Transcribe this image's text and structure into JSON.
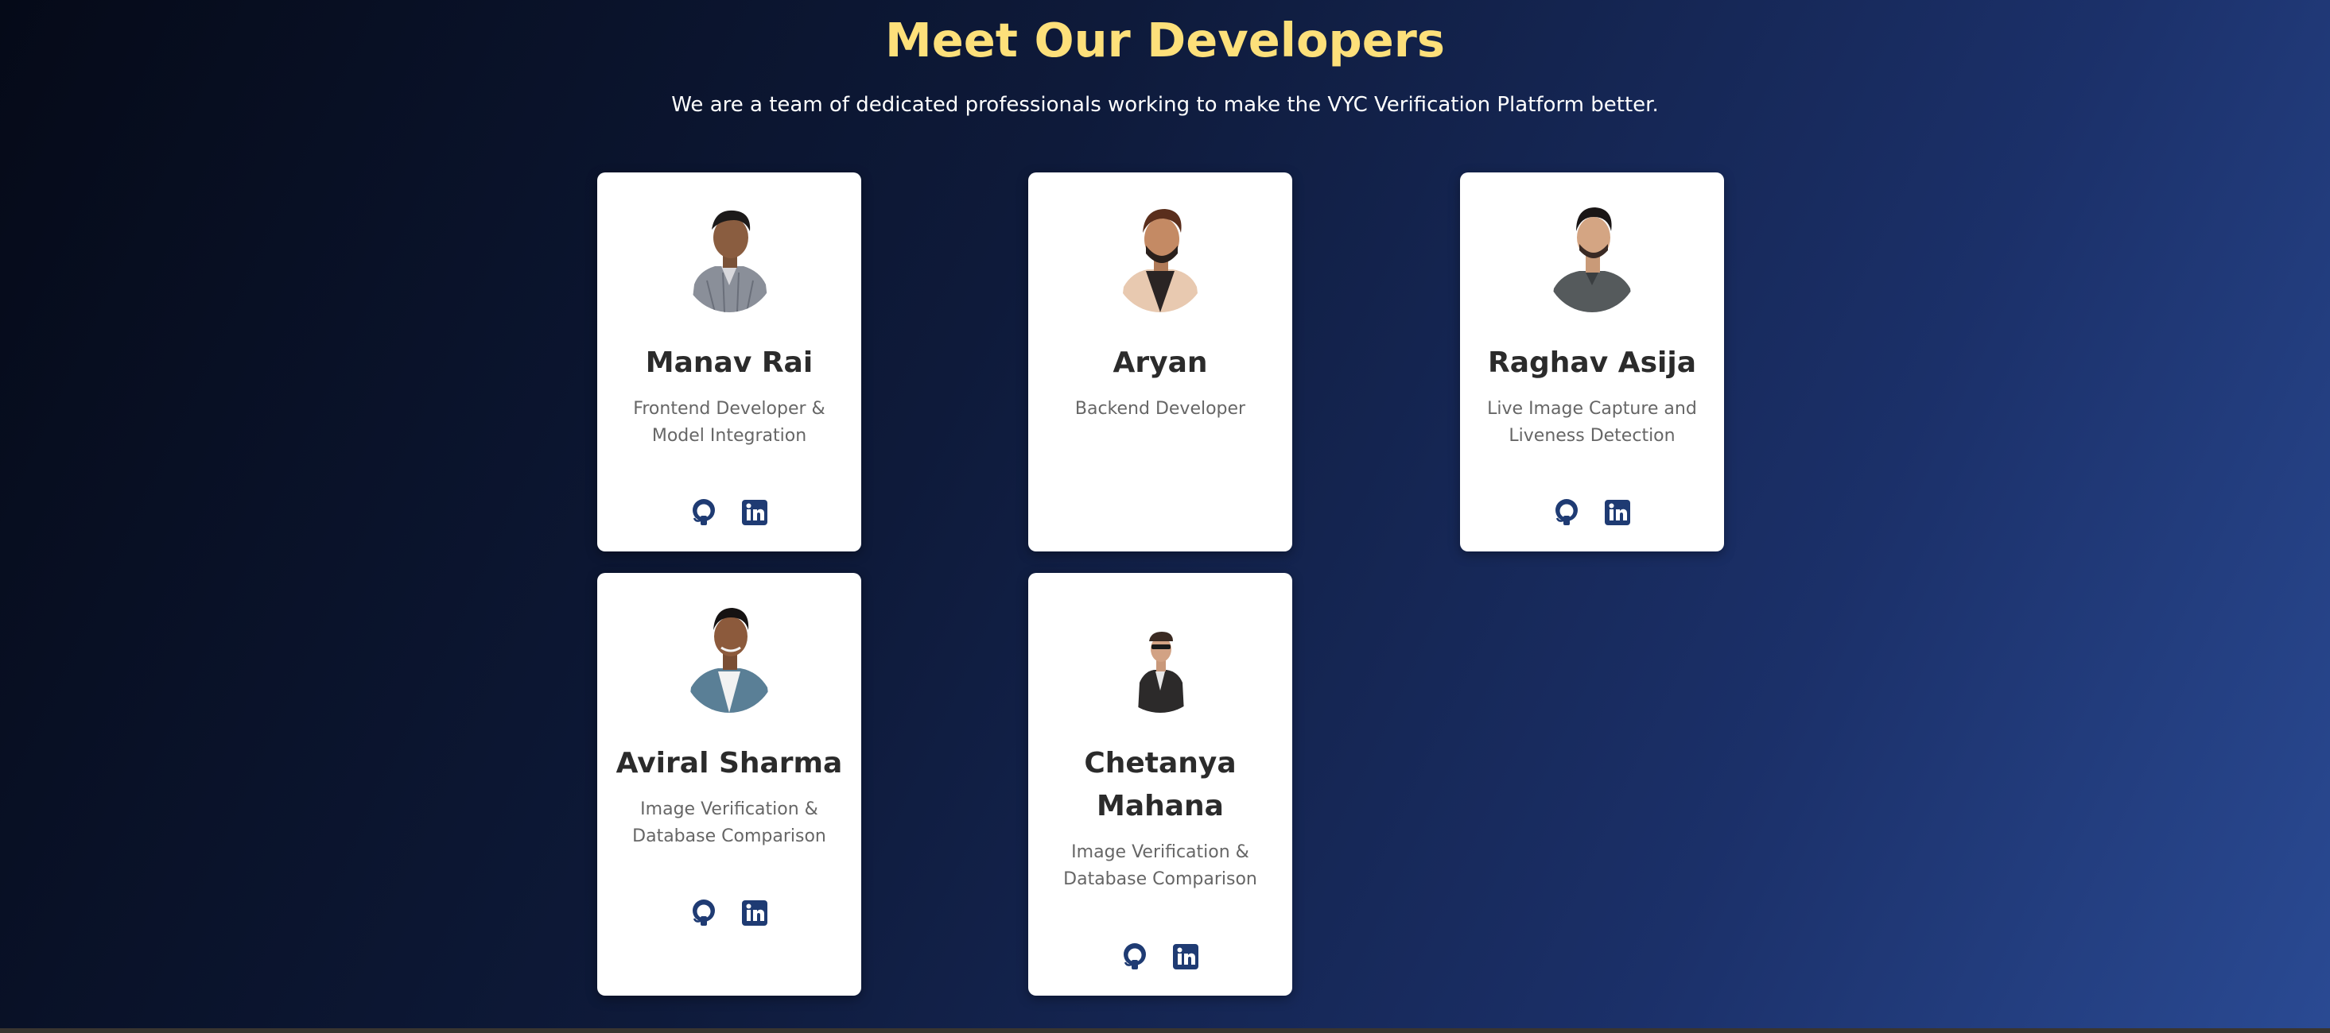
{
  "header": {
    "title": "Meet Our Developers",
    "subtitle": "We are a team of dedicated professionals working to make the VYC Verification Platform better."
  },
  "developers": [
    {
      "name": "Manav Rai",
      "role": "Frontend Developer & Model Integration"
    },
    {
      "name": "Aryan",
      "role": "Backend Developer"
    },
    {
      "name": "Raghav Asija",
      "role": "Live Image Capture and Liveness Detection"
    },
    {
      "name": "Aviral Sharma",
      "role": "Image Verification & Database Comparison"
    },
    {
      "name": "Chetanya Mahana",
      "role": "Image Verification & Database Comparison"
    }
  ],
  "icons": {
    "github": "github-icon",
    "linkedin": "linkedin-icon"
  },
  "colors": {
    "title": "#fde07a",
    "icon": "#1f3b73",
    "card": "#ffffff",
    "name": "#2b2b2b",
    "role": "#666666"
  }
}
